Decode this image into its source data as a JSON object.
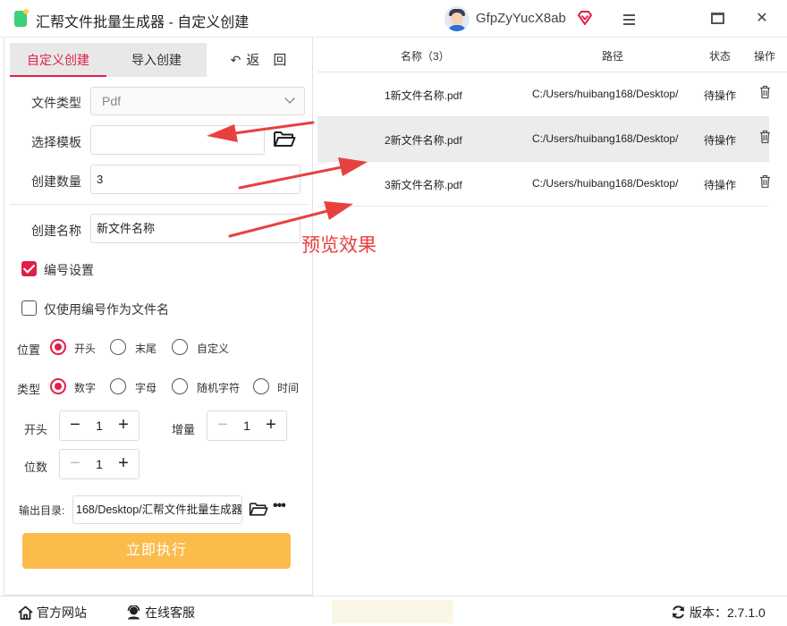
{
  "window": {
    "title": "汇帮文件批量生成器 - 自定义创建",
    "username": "GfpZyYucX8ab"
  },
  "tabs": {
    "custom": "自定义创建",
    "import": "导入创建",
    "back": "返　回"
  },
  "form": {
    "file_type_label": "文件类型",
    "file_type_value": "Pdf",
    "template_label": "选择模板",
    "template_value": "",
    "count_label": "创建数量",
    "count_value": "3",
    "name_label": "创建名称",
    "name_value": "新文件名称",
    "numbering_label": "编号设置",
    "numbering_checked": true,
    "only_number_label": "仅使用编号作为文件名",
    "only_number_checked": false,
    "position_label": "位置",
    "position_options": [
      "开头",
      "末尾",
      "自定义"
    ],
    "position_selected": "开头",
    "type_label": "类型",
    "type_options": [
      "数字",
      "字母",
      "随机字符",
      "时间"
    ],
    "type_selected": "数字",
    "start_label": "开头",
    "start_value": "1",
    "increment_label": "增量",
    "increment_value": "1",
    "digits_label": "位数",
    "digits_value": "1",
    "output_label": "输出目录:",
    "output_value": "168/Desktop/汇帮文件批量生成器",
    "execute_button": "立即执行"
  },
  "table": {
    "col_name": "名称（3）",
    "col_path": "路径",
    "col_status": "状态",
    "col_action": "操作",
    "rows": [
      {
        "name": "1新文件名称.pdf",
        "path": "C:/Users/huibang168/Desktop/",
        "status": "待操作"
      },
      {
        "name": "2新文件名称.pdf",
        "path": "C:/Users/huibang168/Desktop/",
        "status": "待操作"
      },
      {
        "name": "3新文件名称.pdf",
        "path": "C:/Users/huibang168/Desktop/",
        "status": "待操作"
      }
    ],
    "selected_row": 1
  },
  "annotation": {
    "text": "预览效果",
    "color": "#e84040"
  },
  "footer": {
    "website": "官方网站",
    "support": "在线客服",
    "version_label": "版本：",
    "version_value": "2.7.1.0"
  },
  "colors": {
    "accent": "#e0204a",
    "execute": "#fbbc4c"
  }
}
